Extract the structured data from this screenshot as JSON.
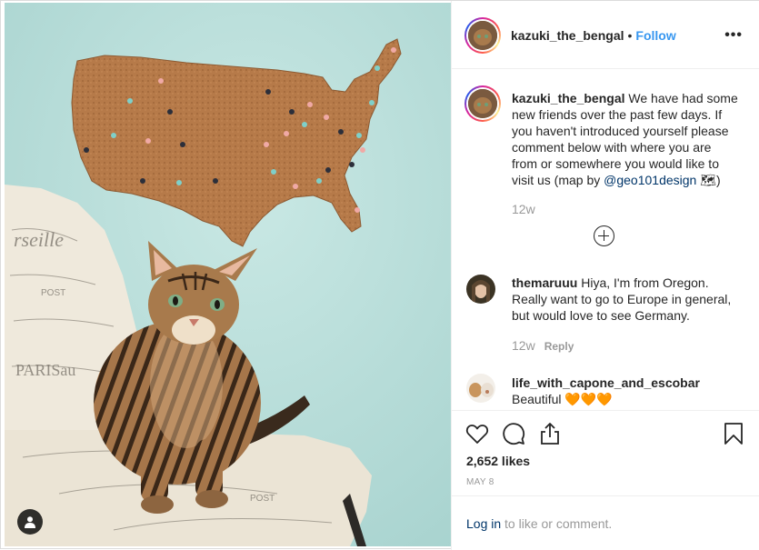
{
  "header": {
    "username": "kazuki_the_bengal",
    "separator": "•",
    "follow_label": "Follow",
    "more_label": "•••"
  },
  "caption": {
    "username": "kazuki_the_bengal",
    "text": " We have had some new friends over the past few days. If you haven't introduced yourself please comment below with where you are from or somewhere you would like to visit us (map by ",
    "mention": "@geo101design",
    "suffix": " 🗺)",
    "time": "12w"
  },
  "comments": [
    {
      "username": "themaruuu",
      "text": " Hiya, I'm from Oregon. Really want to go to Europe in general, but would love to see Germany.",
      "time": "12w",
      "reply_label": "Reply"
    },
    {
      "username": "life_with_capone_and_escobar",
      "text": "Beautiful 🧡🧡🧡"
    }
  ],
  "stats": {
    "likes": "2,652 likes",
    "date": "MAY 8"
  },
  "login": {
    "link": "Log in",
    "rest": " to like or comment."
  },
  "icons": {
    "like": "heart-icon",
    "comment": "comment-icon",
    "share": "share-icon",
    "save": "bookmark-icon",
    "more": "more-options-icon",
    "tag": "user-tag-icon",
    "load_more": "plus-circle-icon"
  },
  "colors": {
    "follow": "#3897f0",
    "mention": "#003569",
    "muted": "#999999",
    "wall": "#b9dedb",
    "cork": "#b67a49"
  }
}
